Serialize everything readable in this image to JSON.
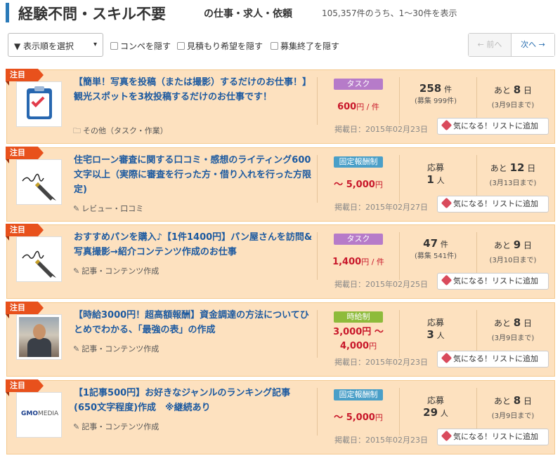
{
  "header": {
    "title": "経験不問・スキル不要",
    "suffix": "の仕事・求人・依頼",
    "count": "105,357件のうち、1〜30件を表示"
  },
  "toolbar": {
    "sort_label": "▼ 表示順を選択",
    "sort_arrow": "▾",
    "filters": [
      "コンペを隠す",
      "見積もり希望を隠す",
      "募集終了を隠す"
    ],
    "prev_label": "← 前へ",
    "next_label": "次へ →"
  },
  "common": {
    "ribbon": "注目",
    "fav_button": "気になる！リストに追加"
  },
  "jobs": [
    {
      "title": "【簡単！写真を投稿（または撮影）するだけのお仕事！】観光スポットを3枚投稿するだけのお仕事です！",
      "category": "その他（タスク・作業）",
      "category_icon": "folder-icon",
      "type": "タスク",
      "price": "600",
      "price_unit": "円 / 件",
      "apply_label": "",
      "apply_num": "258",
      "apply_unit": "件",
      "apply_sub": "(募集 999件)",
      "deadline_prefix": "あと",
      "deadline_days": "8",
      "deadline_unit": "日",
      "deadline_date": "(3月9日まで)",
      "posted": "掲載日：2015年02月23日",
      "thumb": "clipboard-check-icon"
    },
    {
      "title": "住宅ローン審査に関する口コミ・感想のライティング600文字以上（実際に審査を行った方・借り入れを行った方限定)",
      "category": "レビュー・口コミ",
      "category_icon": "pencil-icon",
      "type": "固定報酬制",
      "price": "〜 5,000",
      "price_unit": "円",
      "apply_label": "応募",
      "apply_num": "1",
      "apply_unit": "人",
      "apply_sub": "",
      "deadline_prefix": "あと",
      "deadline_days": "12",
      "deadline_unit": "日",
      "deadline_date": "(3月13日まで)",
      "posted": "掲載日：2015年02月27日",
      "thumb": "fountain-pen-icon"
    },
    {
      "title": "おすすめパンを購入♪【1件1400円】パン屋さんを訪問&写真撮影→紹介コンテンツ作成のお仕事",
      "category": "記事・コンテンツ作成",
      "category_icon": "pencil-icon",
      "type": "タスク",
      "price": "1,400",
      "price_unit": "円 / 件",
      "apply_label": "",
      "apply_num": "47",
      "apply_unit": "件",
      "apply_sub": "(募集 541件)",
      "deadline_prefix": "あと",
      "deadline_days": "9",
      "deadline_unit": "日",
      "deadline_date": "(3月10日まで)",
      "posted": "掲載日：2015年02月25日",
      "thumb": "fountain-pen-icon"
    },
    {
      "title": "【時給3000円！超高額報酬】資金調達の方法についてひとめでわかる、「最強の表」の作成",
      "category": "記事・コンテンツ作成",
      "category_icon": "pencil-icon",
      "type": "時給制",
      "price": "3,000円 〜",
      "price2": "4,000",
      "price_unit": "円",
      "apply_label": "応募",
      "apply_num": "3",
      "apply_unit": "人",
      "apply_sub": "",
      "deadline_prefix": "あと",
      "deadline_days": "8",
      "deadline_unit": "日",
      "deadline_date": "(3月9日まで)",
      "posted": "掲載日：2015年02月23日",
      "thumb": "user-photo"
    },
    {
      "title": "【1記事500円】お好きなジャンルのランキング記事(650文字程度)作成　※継続あり",
      "category": "記事・コンテンツ作成",
      "category_icon": "pencil-icon",
      "type": "固定報酬制",
      "price": "〜 5,000",
      "price_unit": "円",
      "apply_label": "応募",
      "apply_num": "29",
      "apply_unit": "人",
      "apply_sub": "",
      "deadline_prefix": "あと",
      "deadline_days": "8",
      "deadline_unit": "日",
      "deadline_date": "(3月9日まで)",
      "posted": "掲載日：2015年02月23日",
      "thumb": "gmo-media-logo",
      "logo_text_main": "GMO",
      "logo_text_sub": "MEDIA"
    }
  ]
}
